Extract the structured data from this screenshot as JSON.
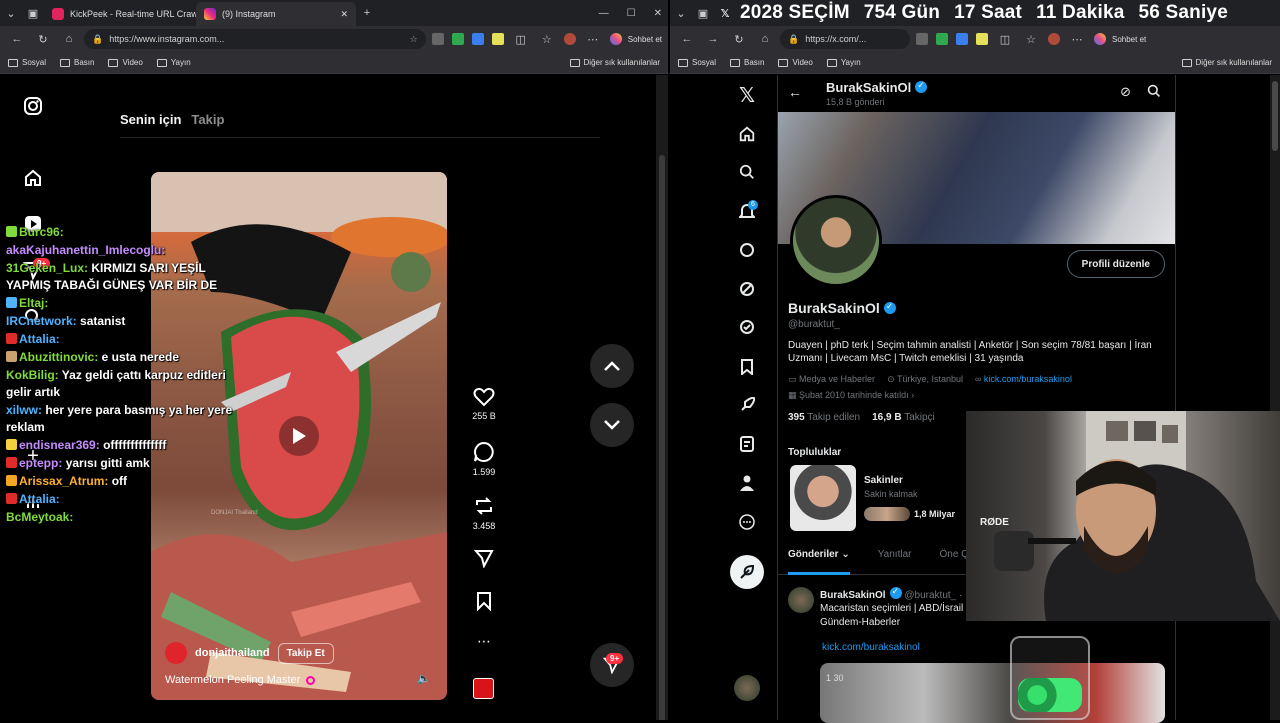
{
  "left_browser": {
    "tabs": [
      {
        "title": "KickPeek - Real-time URL Crawler"
      },
      {
        "title": "(9) Instagram"
      }
    ],
    "url": "https://www.instagram.com...",
    "chat_button_label": "Sohbet et",
    "bookmarks": [
      "Sosyal",
      "Basın",
      "Video",
      "Yayın"
    ],
    "other_bookmarks": "Diğer sık kullanılanlar"
  },
  "instagram": {
    "feed_tabs": {
      "for_you": "Senin için",
      "following": "Takip"
    },
    "notification_badge": "9+",
    "reel": {
      "likes": "255 B",
      "comments": "1.599",
      "reposts": "3.458",
      "author": "donjaithailand",
      "follow_label": "Takip Et",
      "caption": "Watermelon Peeling Master",
      "watermark": "DONJAI Thailand"
    },
    "messages_badge": "9+"
  },
  "stream_chat": [
    {
      "user": "Burc96:",
      "text": "",
      "user_color": "#7fdc3a"
    },
    {
      "user": "akaKajuhanettin_Imlecoglu:",
      "text": "",
      "user_color": "#c58cff"
    },
    {
      "user": "31Geken_Lux:",
      "text": "KIRMIZI SARI YEŞİL YAPMIŞ TABAĞI GÜNEŞ VAR BİR DE",
      "user_color": "#7fdc3a"
    },
    {
      "user": "Eltaj:",
      "text": "",
      "user_color": "#7fdc3a"
    },
    {
      "user": "IRCnetwork:",
      "text": "satanist",
      "user_color": "#4fb3ff"
    },
    {
      "user": "Attalia:",
      "text": "",
      "user_color": "#4fb3ff"
    },
    {
      "user": "Abuzittinovic:",
      "text": "e usta nerede",
      "user_color": "#7fdc3a"
    },
    {
      "user": "KokBilig:",
      "text": "Yaz geldi çattı karpuz editleri gelir artık",
      "user_color": "#7fdc3a"
    },
    {
      "user": "xilww:",
      "text": "her yere para basmış ya her yere reklam",
      "user_color": "#4fb3ff"
    },
    {
      "user": "endisnear369:",
      "text": "offffffffffffff",
      "user_color": "#c58cff"
    },
    {
      "user": "eptepp:",
      "text": "yarısı gitti amk",
      "user_color": "#c58cff"
    },
    {
      "user": "Arissax_Atrum:",
      "text": "off",
      "user_color": "#ffb02e"
    },
    {
      "user": "Attalia:",
      "text": "",
      "user_color": "#4fb3ff"
    },
    {
      "user": "BcMeytoak:",
      "text": "",
      "user_color": "#7fdc3a"
    }
  ],
  "countdown": {
    "year_label": "2028 SEÇİM",
    "days": "754 Gün",
    "hours": "17 Saat",
    "minutes": "11 Dakika",
    "seconds": "56 Saniye"
  },
  "right_browser": {
    "url": "https://x.com/...",
    "chat_button_label": "Sohbet et",
    "bookmarks": [
      "Sosyal",
      "Basın",
      "Video",
      "Yayın"
    ],
    "other_bookmarks": "Diğer sık kullanılanlar"
  },
  "x_profile": {
    "header_name": "BurakSakinOl",
    "post_count": "15,8 B gönderi",
    "edit_profile": "Profili düzenle",
    "display_name": "BurakSakinOl",
    "handle": "@buraktut_",
    "bio": "Duayen | phD terk | Seçim tahmin analisti | Anketör | Son seçim 78/81 başarı | İran Uzmanı | Livecam MsC | Twitch emeklisi | 31 yaşında",
    "category": "Medya ve Haberler",
    "location": "Türkiye, Istanbul",
    "link": "kick.com/buraksakinol",
    "joined": "Şubat 2010 tarihinde katıldı",
    "following_count": "395",
    "following_label": "Takip edilen",
    "followers_count": "16,9 B",
    "followers_label": "Takipçi",
    "communities_title": "Topluluklar",
    "community": {
      "name": "Sakinler",
      "tagline": "Sakin kalmak",
      "members": "1,8 Milyar"
    },
    "tabs": [
      "Gönderiler",
      "Yanıtlar",
      "Öne Ç"
    ],
    "post": {
      "author": "BurakSakinOl",
      "handle": "@buraktut_ ·",
      "text": "Macaristan seçimleri | ABD/İsrail Gündem-Haberler",
      "link": "kick.com/buraksakinol",
      "media_label": "1 30"
    },
    "notification_count": "6"
  },
  "webcam": {
    "mic_brand": "RØDE"
  }
}
